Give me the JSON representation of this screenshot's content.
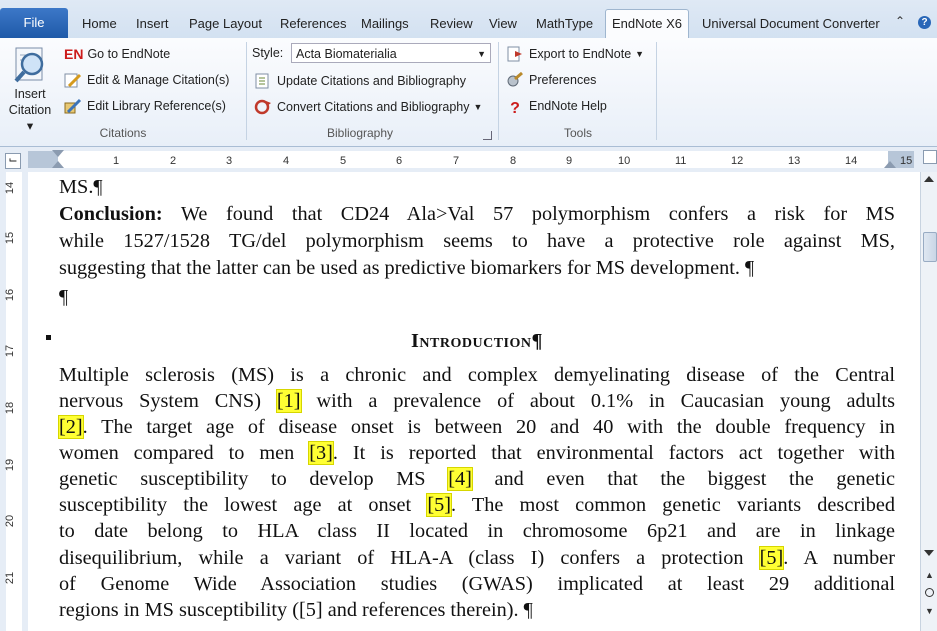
{
  "tabs": {
    "file": "File",
    "items": [
      "Home",
      "Insert",
      "Page Layout",
      "References",
      "Mailings",
      "Review",
      "View",
      "MathType",
      "EndNote X6",
      "Universal Document Converter"
    ],
    "active": "EndNote X6"
  },
  "ribbon": {
    "insert_citation": {
      "line1": "Insert",
      "line2": "Citation"
    },
    "citations_group": {
      "go_to_endnote": "Go to EndNote",
      "edit_manage": "Edit & Manage Citation(s)",
      "edit_library": "Edit Library Reference(s)",
      "label": "Citations"
    },
    "bibliography_group": {
      "style_label": "Style:",
      "style_value": "Acta Biomaterialia",
      "update": "Update Citations and Bibliography",
      "convert": "Convert Citations and Bibliography",
      "label": "Bibliography"
    },
    "tools_group": {
      "export": "Export to EndNote",
      "preferences": "Preferences",
      "help": "EndNote Help",
      "label": "Tools"
    },
    "en_badge": "EN"
  },
  "ruler": {
    "h_ticks": [
      "1",
      "2",
      "3",
      "4",
      "5",
      "6",
      "7",
      "8",
      "9",
      "10",
      "11",
      "12",
      "13",
      "14",
      "15"
    ],
    "v_ticks": [
      "14",
      "15",
      "16",
      "17",
      "18",
      "19",
      "20",
      "21"
    ]
  },
  "document": {
    "ms_line": "MS.¶",
    "conclusion_label": "Conclusion:",
    "conclusion_l1": " We found that CD24 Ala>Val 57 polymorphism confers a risk for MS",
    "conclusion_l2": "while 1527/1528 TG/del polymorphism seems to have a protective role against MS,",
    "conclusion_l3": "suggesting that the latter can be used as predictive biomarkers for MS development. ¶",
    "empty_pilcrow": "¶",
    "heading": "Introduction¶",
    "intro": {
      "l1": "Multiple sclerosis (MS) is a chronic and complex demyelinating disease of the Central",
      "l2a": "nervous System CNS)",
      "c1": "[1]",
      "l2b": "with a prevalence of about 0.1% in Caucasian young adults",
      "c2": "[2]",
      "l3b": ". The target age of disease onset is between 20 and 40 with the double frequency in",
      "l4a": "women compared to men",
      "c3": "[3]",
      "l4b": ". It is reported that environmental factors act together with",
      "l5a": "genetic susceptibility to develop MS",
      "c4": "[4]",
      "l5b": "and even that the biggest the genetic",
      "l6a": "susceptibility the lowest age at onset",
      "c5": "[5]",
      "l6b": ". The most common genetic variants described",
      "l7": "to date belong to HLA class II located in chromosome 6p21 and are in linkage",
      "l8a": "disequilibrium, while a variant of HLA-A (class I) confers a protection",
      "c6": "[5]",
      "l8b": ". A number",
      "l9": "of Genome Wide Association studies (GWAS) implicated at least 29 additional",
      "l10": "regions in MS susceptibility ([5] and references therein). ¶"
    }
  },
  "colors": {
    "highlight": "#ffff33",
    "file_tab": "#2a67b8"
  }
}
